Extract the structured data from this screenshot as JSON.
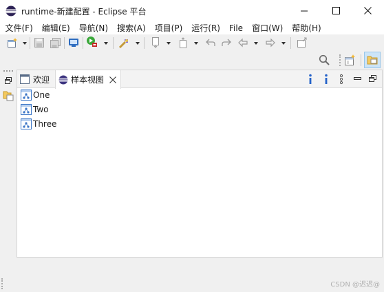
{
  "window": {
    "title": "runtime-新建配置 - Eclipse 平台",
    "controls": [
      "minimize",
      "maximize",
      "close"
    ]
  },
  "menu": {
    "items": [
      "文件(F)",
      "编辑(E)",
      "导航(N)",
      "搜索(A)",
      "项目(P)",
      "运行(R)",
      "File",
      "窗口(W)",
      "帮助(H)"
    ]
  },
  "toolbar": {
    "icons": [
      "new-wizard-icon",
      "save-icon",
      "save-all-icon",
      "console-icon",
      "run-icon",
      "external-tools-icon",
      "annotation-icon",
      "previous-edit-icon",
      "last-edit-icon",
      "back-icon",
      "forward-icon",
      "open-perspective-icon",
      "search-icon",
      "resource-perspective-icon"
    ]
  },
  "tabs": [
    {
      "label": "欢迎",
      "active": false
    },
    {
      "label": "样本视图",
      "active": true
    }
  ],
  "view_actions": [
    "info-action-1",
    "info-action-2",
    "view-menu"
  ],
  "tree": {
    "items": [
      "One",
      "Two",
      "Three"
    ]
  },
  "watermark": "CSDN @迟迟@"
}
